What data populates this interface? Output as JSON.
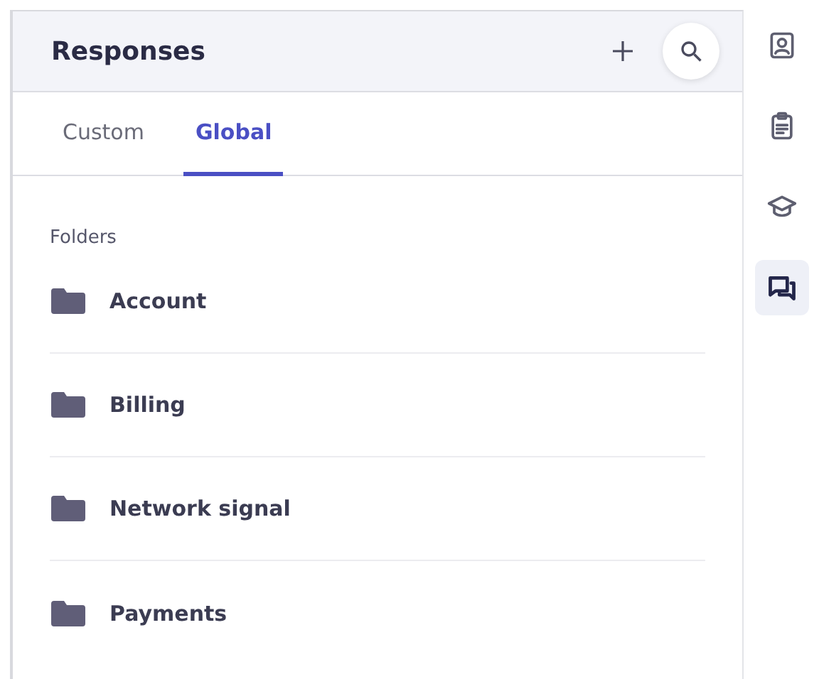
{
  "header": {
    "title": "Responses"
  },
  "tabs": [
    {
      "label": "Custom",
      "selected": false
    },
    {
      "label": "Global",
      "selected": true
    }
  ],
  "section_label": "Folders",
  "folders": [
    {
      "name": "Account"
    },
    {
      "name": "Billing"
    },
    {
      "name": "Network signal"
    },
    {
      "name": "Payments"
    }
  ],
  "rail": [
    {
      "kind": "contact",
      "selected": false
    },
    {
      "kind": "clipboard",
      "selected": false
    },
    {
      "kind": "education",
      "selected": false
    },
    {
      "kind": "chat",
      "selected": true
    }
  ]
}
